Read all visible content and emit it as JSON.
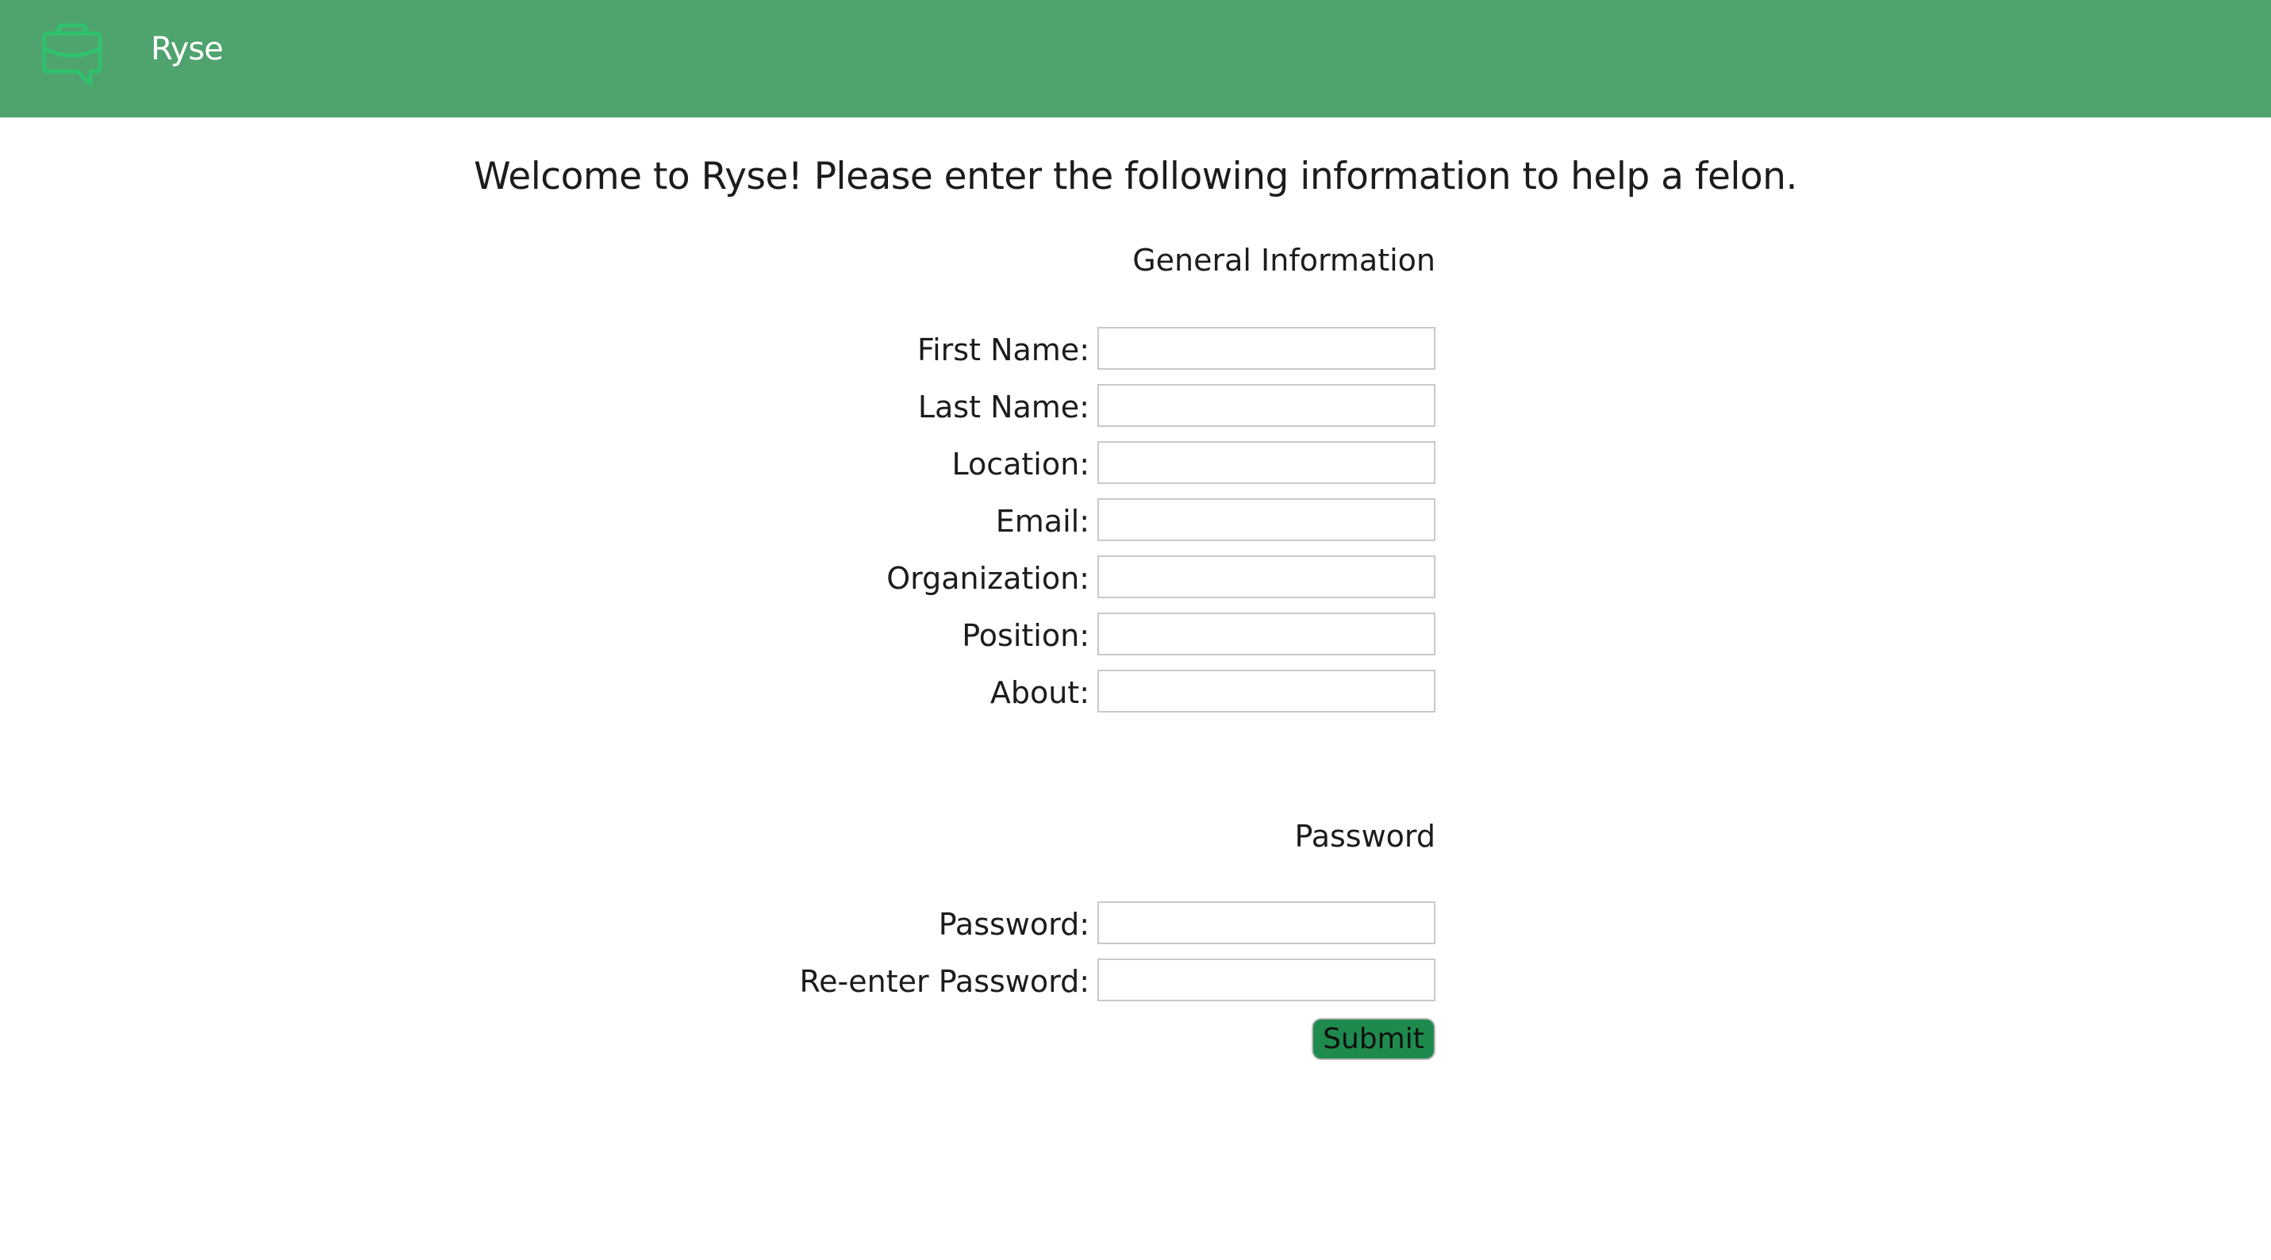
{
  "header": {
    "brand_name": "Ryse",
    "logo_icon": "briefcase-chat-icon",
    "background_color": "#4fa36e",
    "logo_color": "#2fc26c"
  },
  "welcome_text": "Welcome to Ryse! Please enter the following information to help a felon.",
  "general_section": {
    "title": "General Information",
    "fields": [
      {
        "label": "First Name:",
        "value": "",
        "placeholder": ""
      },
      {
        "label": "Last Name:",
        "value": "",
        "placeholder": ""
      },
      {
        "label": "Location:",
        "value": "",
        "placeholder": ""
      },
      {
        "label": "Email:",
        "value": "",
        "placeholder": ""
      },
      {
        "label": "Organization:",
        "value": "",
        "placeholder": ""
      },
      {
        "label": "Position:",
        "value": "",
        "placeholder": ""
      },
      {
        "label": "About:",
        "value": "",
        "placeholder": ""
      }
    ]
  },
  "password_section": {
    "title": "Password",
    "fields": [
      {
        "label": "Password:",
        "value": "",
        "placeholder": ""
      },
      {
        "label": "Re-enter Password:",
        "value": "",
        "placeholder": ""
      }
    ]
  },
  "submit": {
    "label": "Submit",
    "color": "#1f8a4d"
  }
}
